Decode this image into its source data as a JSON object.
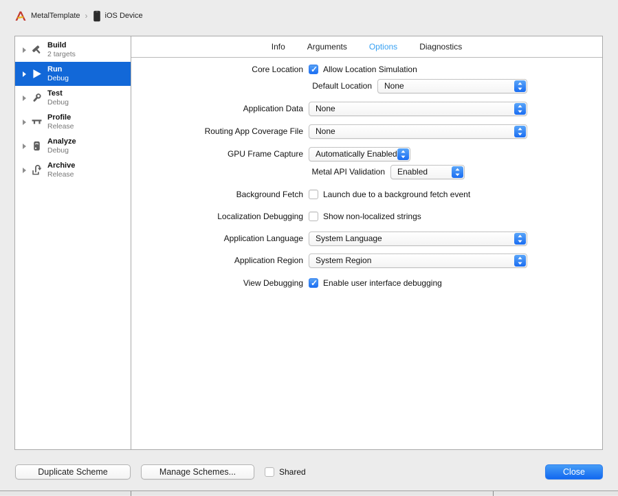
{
  "breadcrumb": {
    "scheme": "MetalTemplate",
    "separator": "›",
    "destination": "iOS Device"
  },
  "sidebar": {
    "items": [
      {
        "title": "Build",
        "subtitle": "2 targets",
        "icon": "hammer-icon",
        "selected": false
      },
      {
        "title": "Run",
        "subtitle": "Debug",
        "icon": "play-icon",
        "selected": true
      },
      {
        "title": "Test",
        "subtitle": "Debug",
        "icon": "wrench-icon",
        "selected": false
      },
      {
        "title": "Profile",
        "subtitle": "Release",
        "icon": "caliper-icon",
        "selected": false
      },
      {
        "title": "Analyze",
        "subtitle": "Debug",
        "icon": "analyze-icon",
        "selected": false
      },
      {
        "title": "Archive",
        "subtitle": "Release",
        "icon": "archive-icon",
        "selected": false
      }
    ]
  },
  "tabs": [
    {
      "label": "Info",
      "selected": false
    },
    {
      "label": "Arguments",
      "selected": false
    },
    {
      "label": "Options",
      "selected": true
    },
    {
      "label": "Diagnostics",
      "selected": false
    }
  ],
  "form": {
    "core_location": {
      "label": "Core Location",
      "checkbox_label": "Allow Location Simulation",
      "checked": true
    },
    "default_location": {
      "label": "Default Location",
      "value": "None"
    },
    "application_data": {
      "label": "Application Data",
      "value": "None"
    },
    "routing_app_coverage": {
      "label": "Routing App Coverage File",
      "value": "None"
    },
    "gpu_frame_capture": {
      "label": "GPU Frame Capture",
      "value": "Automatically Enabled"
    },
    "metal_api_validation": {
      "label": "Metal API Validation",
      "value": "Enabled"
    },
    "background_fetch": {
      "label": "Background Fetch",
      "checkbox_label": "Launch due to a background fetch event",
      "checked": false
    },
    "localization_debugging": {
      "label": "Localization Debugging",
      "checkbox_label": "Show non-localized strings",
      "checked": false
    },
    "application_language": {
      "label": "Application Language",
      "value": "System Language"
    },
    "application_region": {
      "label": "Application Region",
      "value": "System Region"
    },
    "view_debugging": {
      "label": "View Debugging",
      "checkbox_label": "Enable user interface debugging",
      "checked": true
    }
  },
  "footer": {
    "duplicate_label": "Duplicate Scheme",
    "manage_label": "Manage Schemes...",
    "shared_label": "Shared",
    "shared_checked": false,
    "close_label": "Close"
  },
  "colors": {
    "selection_blue": "#1268d8",
    "tab_active_blue": "#36a0f2",
    "control_blue_top": "#58a4f8",
    "control_blue_bottom": "#1c6ef2",
    "window_background": "#ececec"
  }
}
